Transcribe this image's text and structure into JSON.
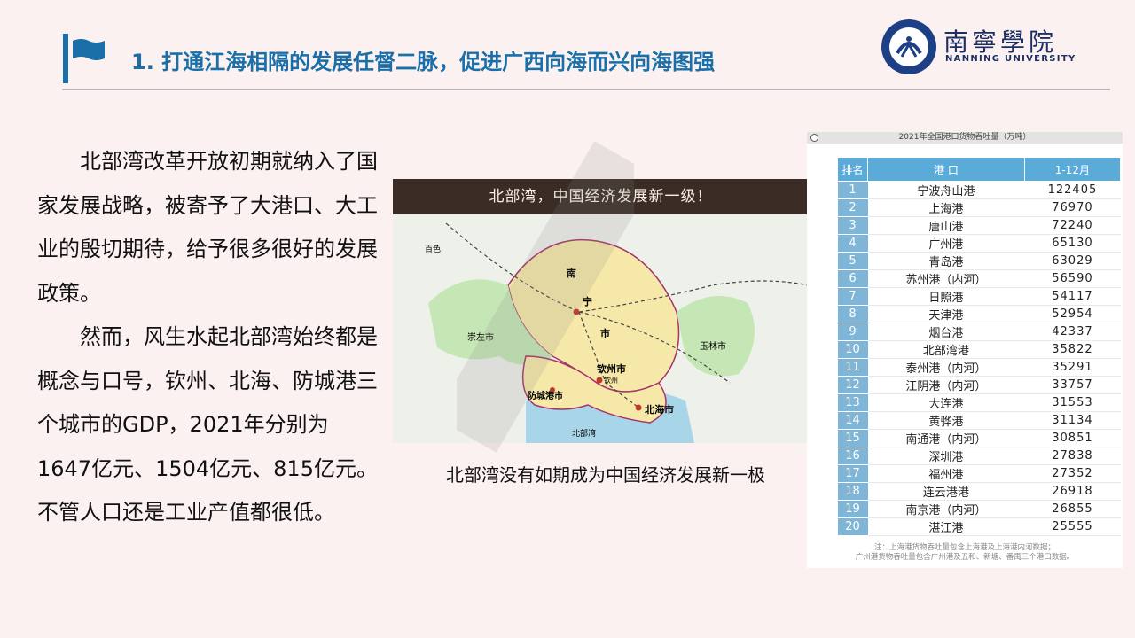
{
  "header": {
    "title": "1. 打通江海相隔的发展任督二脉，促进广西向海而兴向海图强",
    "logo": {
      "name_cn": "南寧學院",
      "name_en": "NANNING UNIVERSITY",
      "icon": "university-emblem"
    },
    "flag_icon": "flag-icon",
    "accent_color": "#1a6fa8"
  },
  "body": {
    "paragraph_1": "北部湾改革开放初期就纳入了国家发展战略，被寄予了大港口、大工业的殷切期待，给予很多很好的发展政策。",
    "paragraph_2": "然而，风生水起北部湾始终都是概念与口号，钦州、北海、防城港三个城市的GDP，2021年分别为1647亿元、1504亿元、815亿元。不管人口还是工业产值都很低。"
  },
  "map": {
    "banner": "北部湾，中国经济发展新一级！",
    "caption": "北部湾没有如期成为中国经济发展新一极",
    "labels": {
      "nanning_a": "南",
      "nanning_b": "宁",
      "nanning_c": "市",
      "qinzhou": "钦州市",
      "fangchenggang": "防城港市",
      "beihai": "北海市",
      "chongzuo": "崇左市",
      "yulin": "玉林市",
      "gulf": "北部湾",
      "baise": "百色",
      "qinzhou_port": "钦州"
    }
  },
  "table": {
    "header": "2021年全国港口货物吞吐量（万吨）",
    "columns": [
      "排名",
      "港 口",
      "1-12月"
    ],
    "rows": [
      {
        "rank": "1",
        "port": "宁波舟山港",
        "value": "122405"
      },
      {
        "rank": "2",
        "port": "上海港",
        "value": "76970"
      },
      {
        "rank": "3",
        "port": "唐山港",
        "value": "72240"
      },
      {
        "rank": "4",
        "port": "广州港",
        "value": "65130"
      },
      {
        "rank": "5",
        "port": "青岛港",
        "value": "63029"
      },
      {
        "rank": "6",
        "port": "苏州港（内河）",
        "value": "56590"
      },
      {
        "rank": "7",
        "port": "日照港",
        "value": "54117"
      },
      {
        "rank": "8",
        "port": "天津港",
        "value": "52954"
      },
      {
        "rank": "9",
        "port": "烟台港",
        "value": "42337"
      },
      {
        "rank": "10",
        "port": "北部湾港",
        "value": "35822"
      },
      {
        "rank": "11",
        "port": "泰州港（内河）",
        "value": "35291"
      },
      {
        "rank": "12",
        "port": "江阴港（内河）",
        "value": "33757"
      },
      {
        "rank": "13",
        "port": "大连港",
        "value": "31553"
      },
      {
        "rank": "14",
        "port": "黄骅港",
        "value": "31134"
      },
      {
        "rank": "15",
        "port": "南通港（内河）",
        "value": "30851"
      },
      {
        "rank": "16",
        "port": "深圳港",
        "value": "27838"
      },
      {
        "rank": "17",
        "port": "福州港",
        "value": "27352"
      },
      {
        "rank": "18",
        "port": "连云港港",
        "value": "26918"
      },
      {
        "rank": "19",
        "port": "南京港（内河）",
        "value": "26855"
      },
      {
        "rank": "20",
        "port": "湛江港",
        "value": "25555"
      }
    ],
    "note_line_1": "注：上海港货物吞吐量包含上海港及上海港内河数据；",
    "note_line_2": "广州港货物吞吐量包含广州港及五和、新塘、番禺三个港口数据。"
  }
}
